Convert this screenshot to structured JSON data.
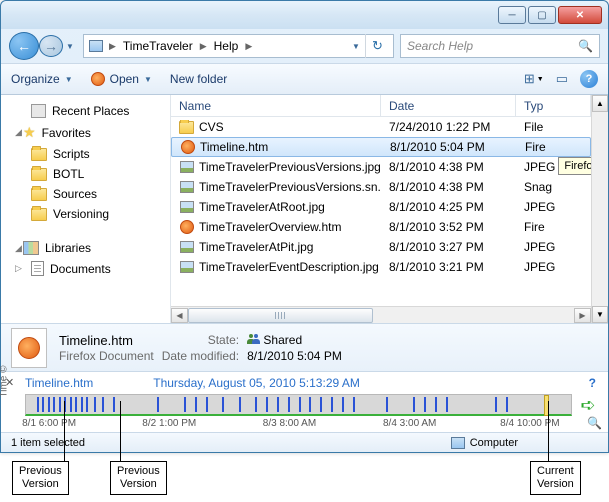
{
  "window": {
    "breadcrumb": {
      "root_icon": "computer",
      "items": [
        "TimeTraveler",
        "Help"
      ]
    },
    "search_placeholder": "Search Help"
  },
  "toolbar": {
    "organize": "Organize",
    "open": "Open",
    "newfolder": "New folder"
  },
  "nav": {
    "recent": "Recent Places",
    "favorites": "Favorites",
    "items": [
      "Scripts",
      "BOTL",
      "Sources",
      "Versioning"
    ],
    "libraries": "Libraries",
    "documents": "Documents"
  },
  "columns": {
    "name": "Name",
    "date": "Date",
    "type": "Typ"
  },
  "files": [
    {
      "icon": "folder",
      "name": "CVS",
      "date": "7/24/2010 1:22 PM",
      "type": "File"
    },
    {
      "icon": "firefox",
      "name": "Timeline.htm",
      "date": "8/1/2010 5:04 PM",
      "type": "Fire",
      "selected": true
    },
    {
      "icon": "image",
      "name": "TimeTravelerPreviousVersions.jpg",
      "date": "8/1/2010 4:38 PM",
      "type": "JPEG"
    },
    {
      "icon": "image",
      "name": "TimeTravelerPreviousVersions.sn...",
      "date": "8/1/2010 4:38 PM",
      "type": "Snag"
    },
    {
      "icon": "image",
      "name": "TimeTravelerAtRoot.jpg",
      "date": "8/1/2010 4:25 PM",
      "type": "JPEG"
    },
    {
      "icon": "firefox",
      "name": "TimeTravelerOverview.htm",
      "date": "8/1/2010 3:52 PM",
      "type": "Fire"
    },
    {
      "icon": "image",
      "name": "TimeTravelerAtPit.jpg",
      "date": "8/1/2010 3:27 PM",
      "type": "JPEG"
    },
    {
      "icon": "image",
      "name": "TimeTravelerEventDescription.jpg",
      "date": "8/1/2010 3:21 PM",
      "type": "JPEG"
    }
  ],
  "tooltip": "Firefox D",
  "details": {
    "filename": "Timeline.htm",
    "filetype": "Firefox Document",
    "state_label": "State:",
    "state_value": "Shared",
    "modified_label": "Date modified:",
    "modified_value": "8/1/2010 5:04 PM"
  },
  "timeline": {
    "side_label": "Time ©",
    "title": "Timeline.htm",
    "datetime": "Thursday, August 05, 2010 5:13:29 AM",
    "axis": [
      "8/1 6:00 PM",
      "8/2 1:00 PM",
      "8/3 8:00 AM",
      "8/4 3:00 AM",
      "8/4 10:00 PM"
    ],
    "tick_positions_pct": [
      2,
      3,
      4,
      5,
      6,
      7,
      8,
      9,
      10,
      11,
      12.5,
      14,
      16,
      24,
      29,
      31,
      33,
      36,
      39,
      42,
      44,
      46,
      48,
      50,
      52,
      54,
      56,
      58,
      60,
      66,
      71,
      73,
      75,
      77,
      86,
      88
    ],
    "cursor_pct": 95
  },
  "status": {
    "selection": "1 item selected",
    "location": "Computer"
  },
  "annotations": {
    "prev1": "Previous\nVersion",
    "prev2": "Previous\nVersion",
    "current": "Current\nVersion"
  }
}
